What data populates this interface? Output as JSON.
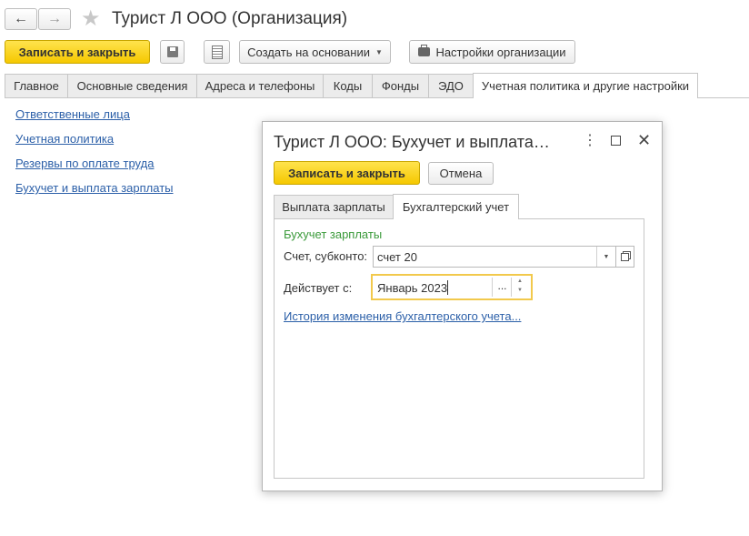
{
  "window": {
    "title": "Турист Л ООО (Организация)"
  },
  "toolbar": {
    "save_close_label": "Записать и закрыть",
    "create_based_label": "Создать на основании",
    "org_settings_label": "Настройки организации"
  },
  "tabs": [
    {
      "label": "Главное"
    },
    {
      "label": "Основные сведения"
    },
    {
      "label": "Адреса и телефоны"
    },
    {
      "label": "Коды"
    },
    {
      "label": "Фонды"
    },
    {
      "label": "ЭДО"
    },
    {
      "label": "Учетная политика и другие настройки"
    }
  ],
  "links": [
    {
      "label": "Ответственные лица"
    },
    {
      "label": "Учетная политика"
    },
    {
      "label": "Резервы по оплате труда"
    },
    {
      "label": "Бухучет и выплата зарплаты"
    }
  ],
  "dialog": {
    "title": "Турист Л ООО: Бухучет и выплата…",
    "save_close_label": "Записать и закрыть",
    "cancel_label": "Отмена",
    "tabs": [
      {
        "label": "Выплата зарплаты"
      },
      {
        "label": "Бухгалтерский учет"
      }
    ],
    "section_title": "Бухучет зарплаты",
    "account_label": "Счет, субконто:",
    "account_value": "счет 20",
    "effective_label": "Действует с:",
    "effective_value": "Январь 2023",
    "ellipsis": "...",
    "history_link": "История изменения бухгалтерского учета..."
  },
  "colors": {
    "accent_yellow": "#f5c800",
    "link_blue": "#2b5fa8",
    "section_green": "#3a9a3a"
  }
}
